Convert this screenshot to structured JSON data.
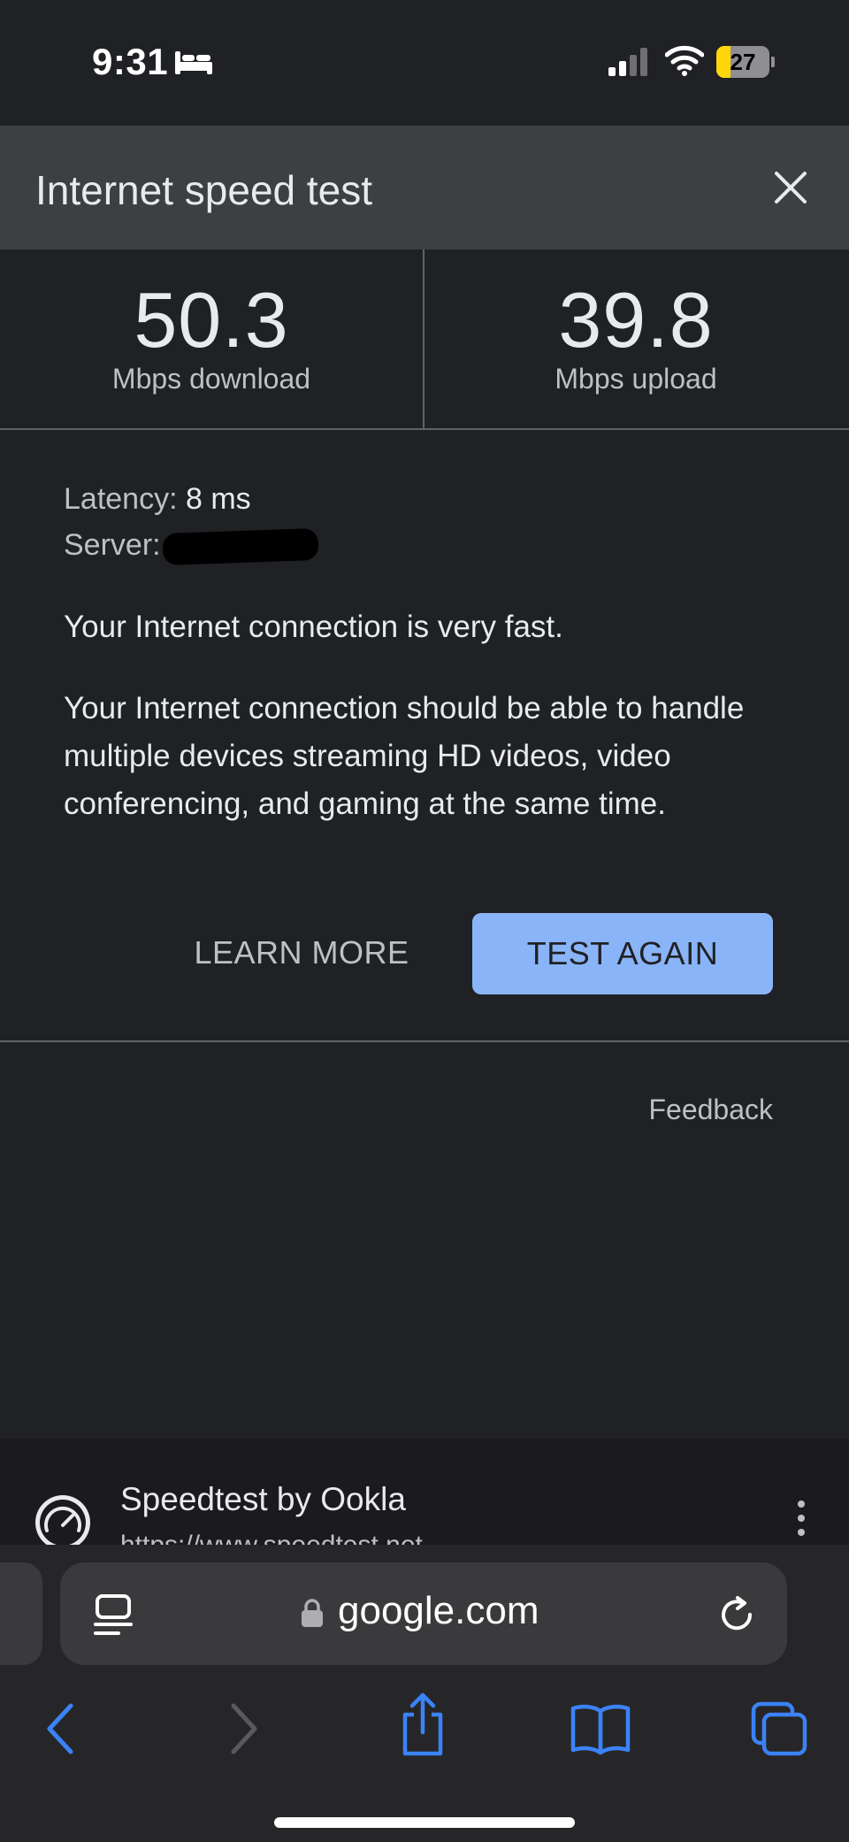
{
  "status_bar": {
    "time": "9:31",
    "battery_level": "27",
    "battery_fraction": 0.27,
    "accent": "#ffd60a",
    "icons": [
      "bed-icon",
      "signal-icon",
      "wifi-icon",
      "battery-icon"
    ]
  },
  "header": {
    "title": "Internet speed test",
    "close_icon": "close-icon"
  },
  "results": {
    "download_value": "50.3",
    "download_unit": "Mbps download",
    "upload_value": "39.8",
    "upload_unit": "Mbps upload"
  },
  "details": {
    "latency_label": "Latency:",
    "latency_value": "8 ms",
    "server_label": "Server:",
    "verdict": "Your Internet connection is very fast.",
    "description": "Your Internet connection should be able to handle multiple devices streaming HD videos, video conferencing, and gaming at the same time."
  },
  "actions": {
    "learn_more": "LEARN MORE",
    "test_again": "TEST AGAIN",
    "button_color": "#8ab4f8"
  },
  "feedback": "Feedback",
  "search_result": {
    "title": "Speedtest by Ookla",
    "url": "https://www.speedtest.net"
  },
  "browser": {
    "url": "google.com",
    "toolbar_icons": [
      "back-icon",
      "forward-icon",
      "share-icon",
      "bookmarks-icon",
      "tabs-icon"
    ]
  }
}
